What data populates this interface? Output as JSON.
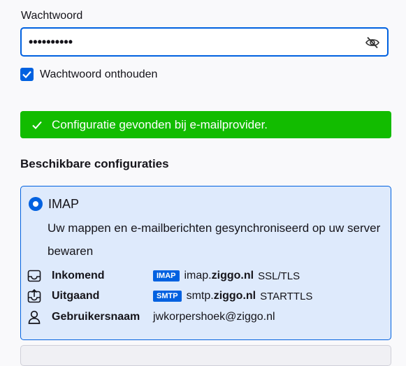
{
  "password": {
    "label": "Wachtwoord",
    "masked_value": "••••••••••",
    "toggle_icon": "eye-slash-icon"
  },
  "remember": {
    "label": "Wachtwoord onthouden",
    "checked": true
  },
  "banner": {
    "text": "Configuratie gevonden bij e-mailprovider.",
    "color": "#12bc00"
  },
  "configs": {
    "heading": "Beschikbare configuraties",
    "imap": {
      "title": "IMAP",
      "description": "Uw mappen en e-mailberichten gesynchroniseerd op uw server bewaren",
      "incoming": {
        "label": "Inkomend",
        "badge": "IMAP",
        "host_prefix": "imap.",
        "host_domain": "ziggo.nl",
        "security": "SSL/TLS"
      },
      "outgoing": {
        "label": "Uitgaand",
        "badge": "SMTP",
        "host_prefix": "smtp.",
        "host_domain": "ziggo.nl",
        "security": "STARTTLS"
      },
      "username": {
        "label": "Gebruikersnaam",
        "value": "jwkorpershoek@ziggo.nl"
      }
    }
  },
  "colors": {
    "accent": "#0061e0",
    "card_bg": "#deeafc"
  }
}
